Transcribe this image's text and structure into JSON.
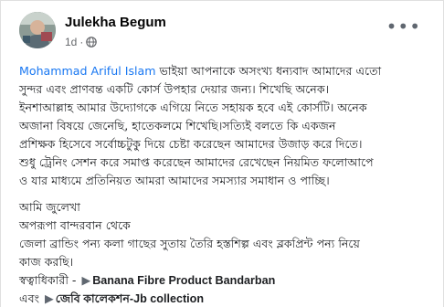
{
  "post": {
    "author": "Julekha Begum",
    "time": "1d",
    "separator": "·",
    "privacy_icon": "globe-icon",
    "more_icon": "more-options-icon",
    "more_glyph": "•••"
  },
  "body": {
    "mention": "Mohammad Ariful Islam",
    "line1_rest": " ভাইয়া আপনাকে অসংখ্য ধন্যবাদ আমাদের এতো",
    "line2": "সুন্দর এবং প্রাণবন্ত  একটি কোর্স উপহার দেয়ার জন্য। শিখেছি অনেক।",
    "line3": "ইনশাআল্লাহ  আমার উদ্যোগকে এগিয়ে নিতে সহায়ক হবে এই কোর্সটি। অনেক",
    "line4": "অজানা বিষয়ে জেনেছি, হাতেকলমে শিখেছি।সত্যিই বলতে কি একজন",
    "line5": "প্রশিক্ষক হিসেবে সর্বোচ্চটুকু দিয়ে চেষ্টা করেছেন আমাদের উজাড় করে দিতে।",
    "line6": "শুধু ট্রেনিং সেশন করে সমাপ্ত করেছেন আমাদের রেখেছেন নিয়মিত ফলোআপে",
    "line7": "ও যার মাধ্যমে প্রতিনিয়ত  আমরা আমাদের সমস্যার সমাধান ও পাচ্ছি।",
    "line8": "আমি জুলেখা",
    "line9": "অপরূপা বান্দরবান থেকে",
    "line10": "জেলা ব্রান্ডিং পন্য কলা গাছের সুতায় তৈরি হস্তশিল্প এবং ব্লকপ্রিন্ট পন্য নিয়ে",
    "line11": "কাজ করছি।",
    "line12_prefix": "স্বত্বাধিকারী -",
    "line12_link": "Banana Fibre Product Bandarban",
    "line13_prefix": "এবং",
    "line13_link": "জেবি কালেকশন-Jb collection",
    "arrow_glyph": "▶"
  }
}
